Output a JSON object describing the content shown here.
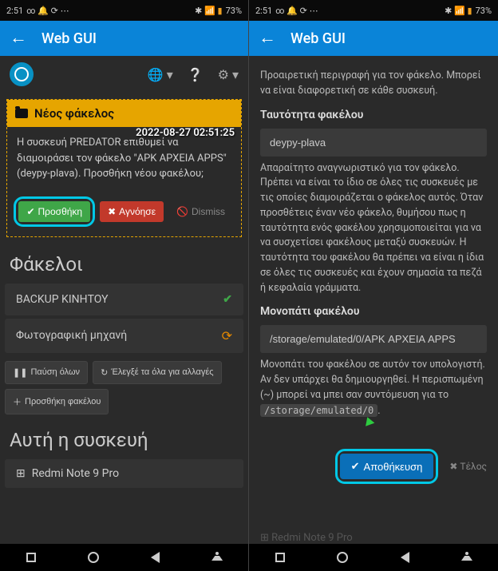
{
  "status": {
    "time": "2:51",
    "icons_left": "∞  🔔  ⟳  ⋯",
    "icons_right": "✱ 📶 📶 73%",
    "battery": "73%"
  },
  "app_title": "Web GUI",
  "left": {
    "notif": {
      "header": "Νέος φάκελος",
      "timestamp": "2022-08-27 02:51:25",
      "body": "Η συσκευή PREDATOR επιθυμεί να διαμοιράσει τον φάκελο \"APK ΑΡΧΕΙΑ APPS\" (deypy-plava). Προσθήκη νέου φακέλου;",
      "add_label": "Προσθήκη",
      "ignore_label": "Αγνόησε",
      "dismiss_label": "Dismiss"
    },
    "folders": {
      "heading": "Φάκελοι",
      "items": [
        {
          "name": "BACKUP ΚΙΝΗΤΟΥ",
          "status": "ok"
        },
        {
          "name": "Φωτογραφική μηχανή",
          "status": "sync"
        }
      ]
    },
    "actions": {
      "pause_all": "Παύση όλων",
      "rescan": "Έλεγξέ τα όλα για αλλαγές",
      "add_folder": "Προσθήκη φακέλου"
    },
    "device": {
      "heading": "Αυτή η συσκευή",
      "name": "Redmi Note 9 Pro"
    }
  },
  "right": {
    "desc_help": "Προαιρετική περιγραφή για τον φάκελο. Μπορεί να είναι διαφορετική σε κάθε συσκευή.",
    "id_label": "Ταυτότητα φακέλου",
    "id_value": "deypy-plava",
    "id_help": "Απαραίτητο αναγνωριστικό για τον φάκελο. Πρέπει να είναι το ίδιο σε όλες τις συσκευές με τις οποίες διαμοιράζεται ο φάκελος αυτός. Όταν προσθέτεις έναν νέο φάκελο, θυμήσου πως η ταυτότητα ενός φακέλου χρησιμοποιείται για να να συσχετίσει φακέλους μεταξύ συσκευών. Η ταυτότητα του φακέλου θα πρέπει να είναι η ίδια σε όλες τις συσκευές και έχουν σημασία τα πεζά ή κεφαλαία γράμματα.",
    "path_label": "Μονοπάτι φακέλου",
    "path_value": "/storage/emulated/0/APK ΑΡΧΕΙΑ APPS",
    "path_help_pre": "Μονοπάτι του φακέλου σε αυτόν τον υπολογιστή. Αν δεν υπάρχει θα δημιουργηθεί. Η περισπωμένη (~) μπορεί να μπει σαν συντόμευση για το ",
    "path_help_code": "/storage/emulated/0",
    "save_label": "Αποθήκευση",
    "close_label": "Τέλος",
    "faded_device": "Redmi Note 9 Pro"
  }
}
